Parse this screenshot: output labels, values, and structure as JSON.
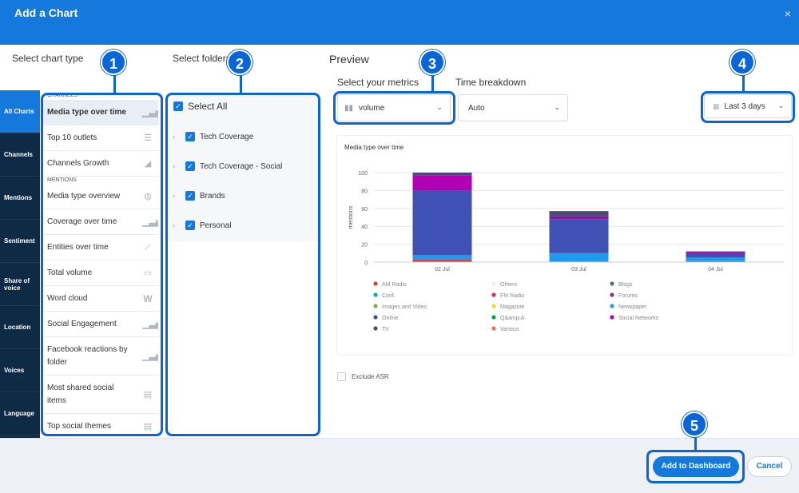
{
  "dialog": {
    "title": "Add a Chart",
    "close": "×"
  },
  "sections": {
    "chart_type": "Select chart type",
    "folders": "Select folders",
    "preview": "Preview"
  },
  "sidebar": {
    "tabs": [
      "All Charts",
      "Channels",
      "Mentions",
      "Sentiment",
      "Share of voice",
      "Location",
      "Voices",
      "Language"
    ],
    "active": 0
  },
  "chart_types": {
    "group_channels": "CHANNELS",
    "group_mentions": "MENTIONS",
    "channels_items": [
      {
        "label": "Media type over time",
        "icon": "bar-chart-icon"
      },
      {
        "label": "Top 10 outlets",
        "icon": "horizontal-bar-icon"
      },
      {
        "label": "Channels Growth",
        "icon": "area-chart-icon"
      }
    ],
    "mentions_items": [
      {
        "label": "Media type overview",
        "icon": "donut-icon"
      },
      {
        "label": "Coverage over time",
        "icon": "bar-chart-icon"
      },
      {
        "label": "Entities over time",
        "icon": "line-chart-icon"
      },
      {
        "label": "Total volume",
        "icon": "number-icon"
      },
      {
        "label": "Word cloud",
        "icon": "word-icon"
      },
      {
        "label": "Social Engagement",
        "icon": "bar-chart-icon"
      },
      {
        "label": "Facebook reactions by folder",
        "icon": "bar-chart-icon"
      },
      {
        "label": "Most shared social items",
        "icon": "table-icon"
      },
      {
        "label": "Top social themes",
        "icon": "table-icon"
      }
    ]
  },
  "folders": {
    "select_all": "Select All",
    "items": [
      "Tech Coverage",
      "Tech Coverage - Social",
      "Brands",
      "Personal"
    ]
  },
  "metrics": {
    "label": "Select your metrics",
    "value": "volume",
    "time_label": "Time breakdown",
    "time_value": "Auto",
    "date_range": "Last 3 days"
  },
  "exclude_asr": "Exclude ASR",
  "buttons": {
    "add": "Add to Dashboard",
    "cancel": "Cancel"
  },
  "badges": [
    "1",
    "2",
    "3",
    "4",
    "5"
  ],
  "chart_data": {
    "type": "bar",
    "stacked": true,
    "title": "Media type over time",
    "ylabel": "mentions",
    "ylim": [
      0,
      100
    ],
    "yticks": [
      0,
      20,
      40,
      60,
      80,
      100
    ],
    "categories": [
      "02 Jul",
      "03 Jul",
      "04 Jul"
    ],
    "series": [
      {
        "name": "AM Radio",
        "color": "#e53935",
        "values": [
          3,
          0,
          1
        ]
      },
      {
        "name": "Others",
        "color": "#eeeeee",
        "values": [
          0,
          0,
          0
        ]
      },
      {
        "name": "Blogs",
        "color": "#546e7a",
        "values": [
          0,
          0,
          0
        ]
      },
      {
        "name": "Conf.",
        "color": "#00acc1",
        "values": [
          0,
          0,
          0
        ]
      },
      {
        "name": "FM Radio",
        "color": "#e91e63",
        "values": [
          0,
          0,
          0
        ]
      },
      {
        "name": "Forums",
        "color": "#8e24aa",
        "values": [
          0,
          0,
          0
        ]
      },
      {
        "name": "Images and Video",
        "color": "#7cb342",
        "values": [
          0,
          0,
          0
        ]
      },
      {
        "name": "Magazine",
        "color": "#fdd835",
        "values": [
          0,
          0,
          0
        ]
      },
      {
        "name": "Newspaper",
        "color": "#1e9bf0",
        "values": [
          5,
          10,
          4
        ]
      },
      {
        "name": "Online",
        "color": "#3f51b5",
        "values": [
          72,
          38,
          4
        ]
      },
      {
        "name": "Q&amp;A",
        "color": "#00a152",
        "values": [
          0,
          0,
          0
        ]
      },
      {
        "name": "Social Networks",
        "color": "#b000b5",
        "values": [
          17,
          3,
          2
        ]
      },
      {
        "name": "TV",
        "color": "#4a4a72",
        "values": [
          3,
          6,
          1
        ]
      },
      {
        "name": "Various",
        "color": "#ff7043",
        "values": [
          0,
          0,
          0
        ]
      }
    ],
    "legend": "bottom"
  }
}
